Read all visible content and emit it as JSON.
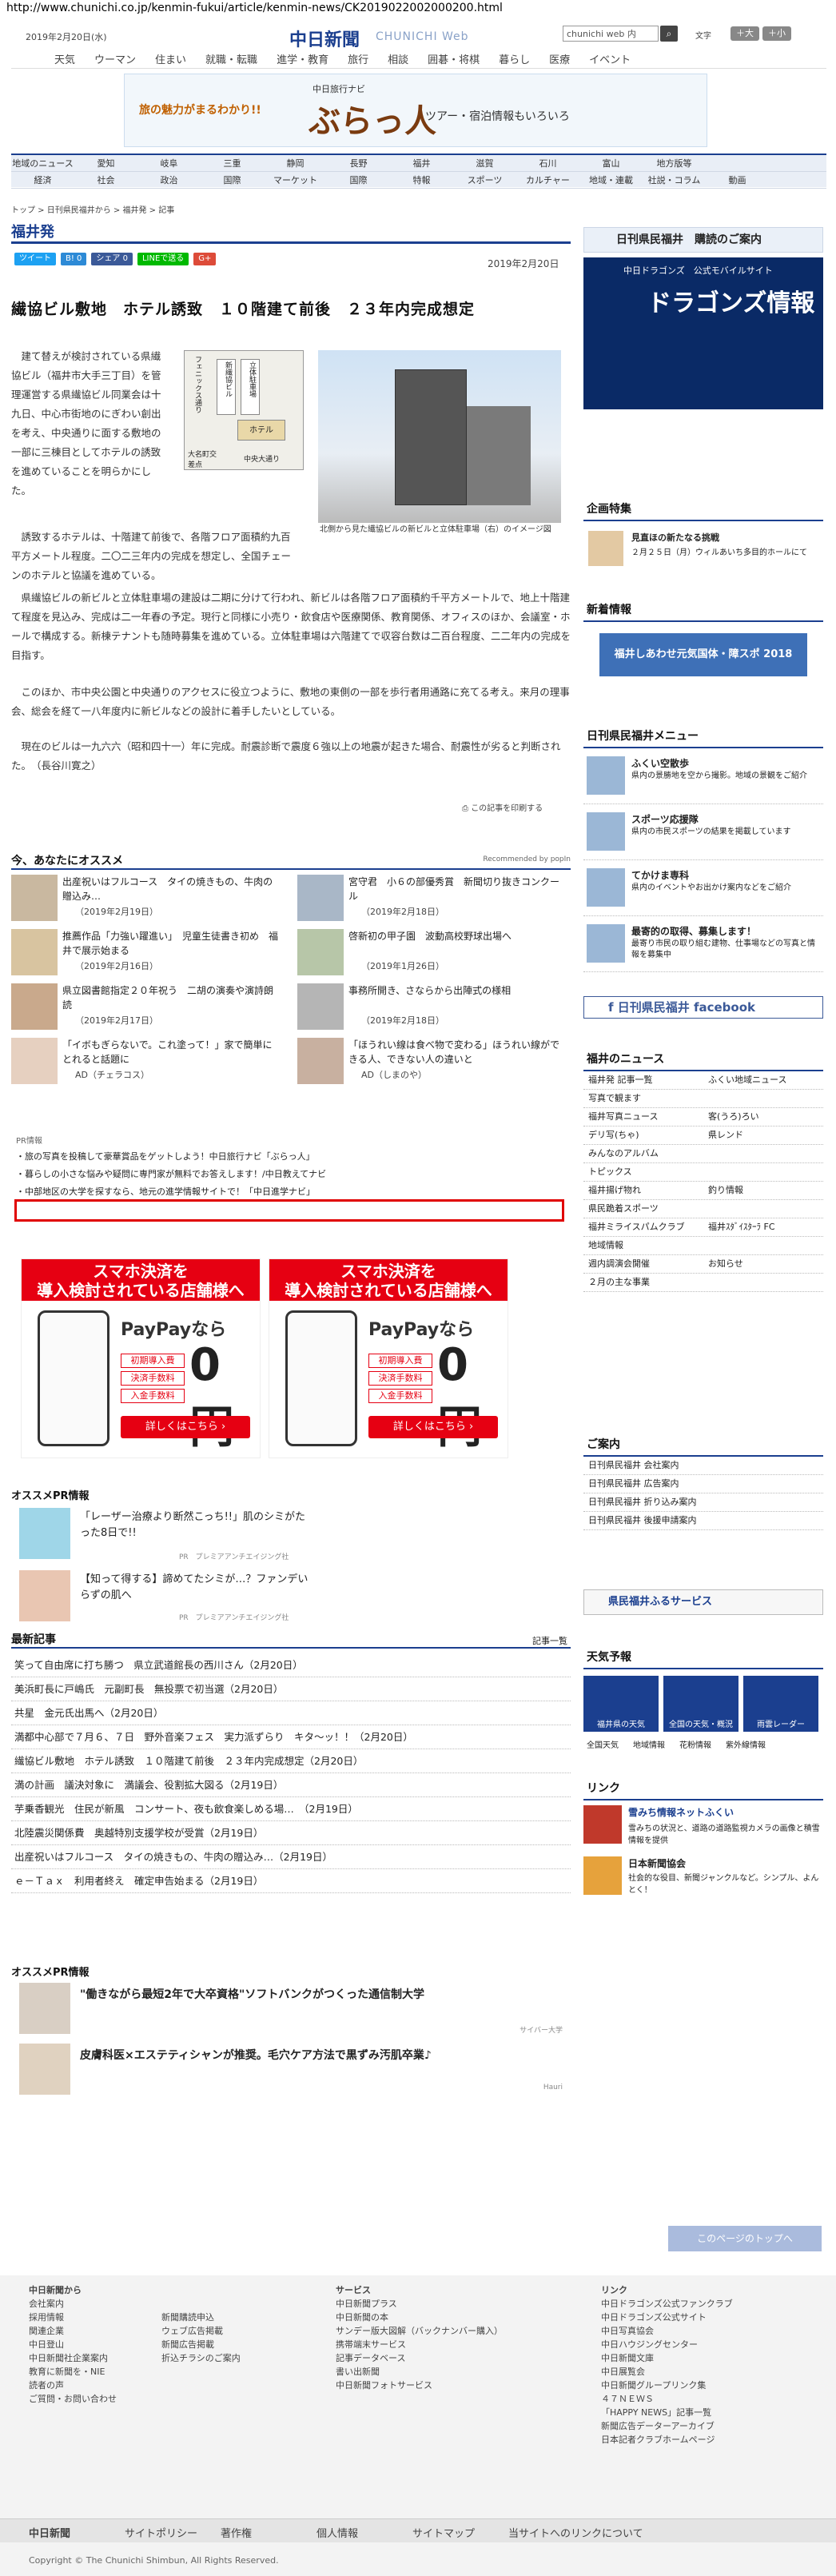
{
  "url": "http://www.chunichi.co.jp/kenmin-fukui/article/kenmin-news/CK2019022002000200.html",
  "header": {
    "date": "2019年2月20日(水)",
    "logo": "中日新聞",
    "logo_sub": "CHUNICHI Web",
    "search_value": "chunichi web 内",
    "font_label": "文字",
    "font_small": "＋小",
    "font_large": "＋大"
  },
  "gnav": [
    "天気",
    "ウーマン",
    "住まい",
    "就職・転職",
    "進学・教育",
    "旅行",
    "相談",
    "囲碁・将棋",
    "暮らし",
    "医療",
    "イベント"
  ],
  "banner": {
    "left": "旅の魅力がまるわかり!!",
    "mid": "中日旅行ナビ",
    "title": "ぶらっ人",
    "right": "ツアー・宿泊情報もいろいろ"
  },
  "subnav": [
    [
      "地域のニュース",
      "愛知",
      "岐阜",
      "三重",
      "静岡",
      "長野",
      "福井",
      "滋賀",
      "石川",
      "富山",
      "地方版等"
    ],
    [
      "経済",
      "社会",
      "政治",
      "国際",
      "マーケット",
      "国際",
      "特報",
      "スポーツ",
      "カルチャー",
      "地域・連載",
      "社説・コラム",
      "動画"
    ]
  ],
  "breadcrumb": "トップ > 日刊県民福井から > 福井発 > 記事",
  "section_title": "福井発",
  "share": [
    "ツイート",
    "B! 0",
    "シェア 0",
    "LINEで送る",
    "G+"
  ],
  "article": {
    "date": "2019年2月20日",
    "headline": "繊協ビル敷地　ホテル誘致　１０階建て前後　２３年内完成想定",
    "p1": "　建て替えが検討されている県繊協ビル（福井市大手三丁目）を管理運営する県繊協ビル同業会は十九日、中心市街地のにぎわい創出を考え、中央通りに面する敷地の一部に三棟目としてホテルの誘致を進めていることを明らかにした。",
    "p1b": "　誘致するホテルは、十階建て前後で、各階フロア面積約九百平方メートル程度。二〇二三年内の完成を想定し、全国チェーンのホテルと協議を進めている。",
    "p2": "　県繊協ビルの新ビルと立体駐車場の建設は二期に分けて行われ、新ビルは各階フロア面積約千平方メートルで、地上十階建て程度を見込み、完成は二一年春の予定。現行と同様に小売り・飲食店や医療関係、教育関係、オフィスのほか、会議室・ホールで構成する。新棟テナントも随時募集を進めている。立体駐車場は六階建てで収容台数は二百台程度、二二年内の完成を目指す。",
    "p3": "　このほか、市中央公園と中央通りのアクセスに役立つように、敷地の東側の一部を歩行者用通路に充てる考え。来月の理事会、総会を経て一八年度内に新ビルなどの設計に着手したいとしている。",
    "p4": "　現在のビルは一九六六（昭和四十一）年に完成。耐震診断で震度６強以上の地震が起きた場合、耐震性が劣ると判断された。　（長谷川寛之）",
    "photo_caption": "北側から見た繊協ビルの新ビルと立体駐車場（右）のイメージ図",
    "map_labels": [
      "大名町交差点",
      "新繊協ビル",
      "立体駐車場",
      "ホテル",
      "フェニックス通り",
      "中央大通り"
    ],
    "print": "この記事を印刷する"
  },
  "recommend": {
    "title": "今、あなたにオススメ",
    "by": "Recommended by popIn",
    "items": [
      {
        "t": "出産祝いはフルコース　タイの焼きもの、牛肉の贈込み…",
        "d": "（2019年2月19日）"
      },
      {
        "t": "宮守君　小６の部優秀賞　新聞切り抜きコンクール",
        "d": "（2019年2月18日）"
      },
      {
        "t": "推薦作品「力強い躍進い」　児童生徒書き初め　福井で展示始まる",
        "d": "（2019年2月16日）"
      },
      {
        "t": "啓新初の甲子園　波動高校野球出場へ",
        "d": "（2019年1月26日）"
      },
      {
        "t": "県立図書館指定２０年祝う　二胡の演奏や演詩朗読",
        "d": "（2019年2月17日）"
      },
      {
        "t": "事務所開き、さならから出陣式の様相",
        "d": "（2019年2月18日）"
      },
      {
        "t": "「イボもぎらないで。これ塗って！」家で簡単にとれると話題に",
        "d": "AD（チェラコス）"
      },
      {
        "t": "「ほうれい線は食べ物で変わる」ほうれい線がで きる人、できない人の違いと",
        "d": "AD（しまのや）"
      }
    ]
  },
  "pr": {
    "label": "PR情報",
    "lines": [
      "・旅の写真を投稿して豪華賞品をゲットしよう！中日旅行ナビ「ぶらっ人」",
      "・暮らしの小さな悩みや疑問に専門家が無料でお答えします！/中日教えてナビ",
      "・中部地区の大学を探すなら、地元の進学情報サイトで！「中日進学ナビ」"
    ]
  },
  "ad": {
    "top": "スマホ決済を\n導入検討されている店舗様へ",
    "brand": "PayPayなら",
    "rows": [
      "初期導入費",
      "決済手数料",
      "入金手数料"
    ],
    "zero": "0円",
    "more": "詳しくはこちら ›"
  },
  "pr2": {
    "title": "オススメPR情報",
    "items": [
      {
        "t": "「レーザー治療より断然こっち!!」肌のシミがたった8日で!!",
        "s": "PR　プレミアアンチエイジング社"
      },
      {
        "t": "【知って得する】諦めてたシミが…？ファンデいらずの肌へ",
        "s": "PR　プレミアアンチエイジング社"
      }
    ]
  },
  "latest": {
    "title": "最新記事",
    "more": "記事一覧",
    "items": [
      "笑って自由席に打ち勝つ　県立武道館長の西川さん（2月20日）",
      "美浜町長に戸嶋氏　元副町長　無投票で初当選（2月20日）",
      "共星　金元氏出馬へ（2月20日）",
      "満都中心部で７月６、７日　野外音楽フェス　実力派ずらり　キタ～ッ！！（2月20日）",
      "繊協ビル敷地　ホテル誘致　１０階建て前後　２３年内完成想定（2月20日）",
      "満の計画　議決対象に　満議会、役割拡大図る（2月19日）",
      "芋乗香観光　住民が新風　コンサート、夜も飲食楽しめる場…　（2月19日）",
      "北陸震災関係費　奥越特別支援学校が受賞（2月19日）",
      "出産祝いはフルコース　タイの焼きもの、牛肉の贈込み…（2月19日）",
      "ｅ－Ｔａｘ　利用者終え　確定申告始まる（2月19日）"
    ]
  },
  "pr3": {
    "title": "オススメPR情報",
    "items": [
      {
        "t": "\"働きながら最短2年で大卒資格\"ソフトバンクがつくった通信制大学",
        "s": "サイバー大学"
      },
      {
        "t": "皮膚科医×エステティシャンが推奨。毛穴ケア方法で黒ずみ汚肌卒業♪",
        "s": "Hauri"
      }
    ]
  },
  "side": {
    "purchase": "日刊県民福井　購読のご案内",
    "dragons": {
      "l1": "中日ドラゴンズ　公式モバイルサイト",
      "l2": "ドラゴンズ情報"
    },
    "kikaku": "企画特集",
    "kikaku_item": {
      "t": "見直ほの新たなる挑戦",
      "d": "２月２５日（月）ウィルあいち多目的ホールにて"
    },
    "shinchaku": "新着情報",
    "shinchaku_banner": "福井しあわせ元気国体・障スポ 2018",
    "menu": "日刊県民福井メニュー",
    "menu_items": [
      {
        "t": "ふくい空散歩",
        "d": "県内の景勝地を空から撮影。地域の景観をご紹介"
      },
      {
        "t": "スポーツ応援隊",
        "d": "県内の市民スポーツの結果を掲載しています"
      },
      {
        "t": "てかけま専科",
        "d": "県内のイベントやお出かけ案内などをご紹介"
      },
      {
        "t": "最寄的の取得、募集します！",
        "d": "最寄り市民の取り組む建物、仕事場などの写真と情報を募集中"
      }
    ],
    "fb": "日刊県民福井 facebook",
    "fukui_news": "福井のニュース",
    "fn": [
      [
        "福井発 記事一覧",
        "ふくい地域ニュース"
      ],
      [
        "写真で観ます",
        ""
      ],
      [
        "福井写真ニュース",
        "客(うろ)ろい"
      ],
      [
        "デリ写(ちゃ)",
        "県レンド"
      ],
      [
        "みんなのアルバム",
        ""
      ],
      [
        "トピックス",
        ""
      ],
      [
        "福井揚げ物れ",
        "釣り情報"
      ],
      [
        "県民跪着スポーツ",
        ""
      ],
      [
        "福井ミライスパムクラブ",
        "福井ｽﾀﾞｲｽﾀｰﾗ FC"
      ],
      [
        "地域情報",
        ""
      ],
      [
        "週内調演会開催",
        "お知らせ"
      ],
      [
        "２月の主な事業",
        ""
      ]
    ],
    "goannai": "ご案内",
    "ga": [
      "日刊県民福井 会社案内",
      "日刊県民福井 広告案内",
      "日刊県民福井 折り込み案内",
      "日刊県民福井 後援申請案内"
    ],
    "furusato": "県民福井ふるサービス",
    "tenki": "天気予報",
    "tenki_items": [
      "福井県の天気",
      "全国の天気・概況",
      "雨雲レーダー"
    ],
    "tenki_links": [
      "全国天気",
      "地域情報",
      "花粉情報",
      "紫外線情報"
    ],
    "link": "リンク",
    "link_items": [
      {
        "t": "雪みち情報ネットふくい",
        "d": "雪みちの状況と、道路の道路監視カメラの画像と積雪情報を提供"
      },
      {
        "t": "日本新聞協会",
        "d": "社会的な役目、新聞ジャンクルなど。シンプル、よんとく！"
      }
    ]
  },
  "footer": {
    "back": "このページのトップへ",
    "c1": [
      "中日新聞から",
      "会社案内",
      "採用情報",
      "関連企業",
      "中日登山",
      "中日新聞社企業案内",
      "教育に新聞を・NIE",
      "読者の声",
      "ご質問・お問い合わせ"
    ],
    "c2": [
      "",
      "",
      "新聞購読申込",
      "ウェブ広告掲載",
      "新聞広告掲載",
      "折込チラシのご案内"
    ],
    "c3": [
      "サービス",
      "中日新聞プラス",
      "中日新聞の本",
      "サンデー版大図解（バックナンバー購入）",
      "携帯端末サービス",
      "記事データベース",
      "書い出新聞",
      "中日新聞フォトサービス"
    ],
    "c4": [
      "リンク",
      "中日ドラゴンズ公式ファンクラブ",
      "中日ドラゴンズ公式サイト",
      "中日写真協会",
      "中日ハウジングセンター",
      "中日新聞文庫",
      "中日展覧会",
      "中日新聞グループリンク集",
      "４７ＮＥＷＳ",
      "「HAPPY NEWS」記事一覧",
      "新聞広告データーアーカイブ",
      "日本記者クラブホームページ"
    ],
    "bar": [
      "中日新聞",
      "サイトポリシー",
      "著作権",
      "個人情報",
      "サイトマップ",
      "当サイトへのリンクについて"
    ],
    "copy": "Copyright © The Chunichi Shimbun, All Rights Reserved."
  },
  "colors": {
    "brand": "#1b3f8f",
    "red": "#e60012"
  }
}
